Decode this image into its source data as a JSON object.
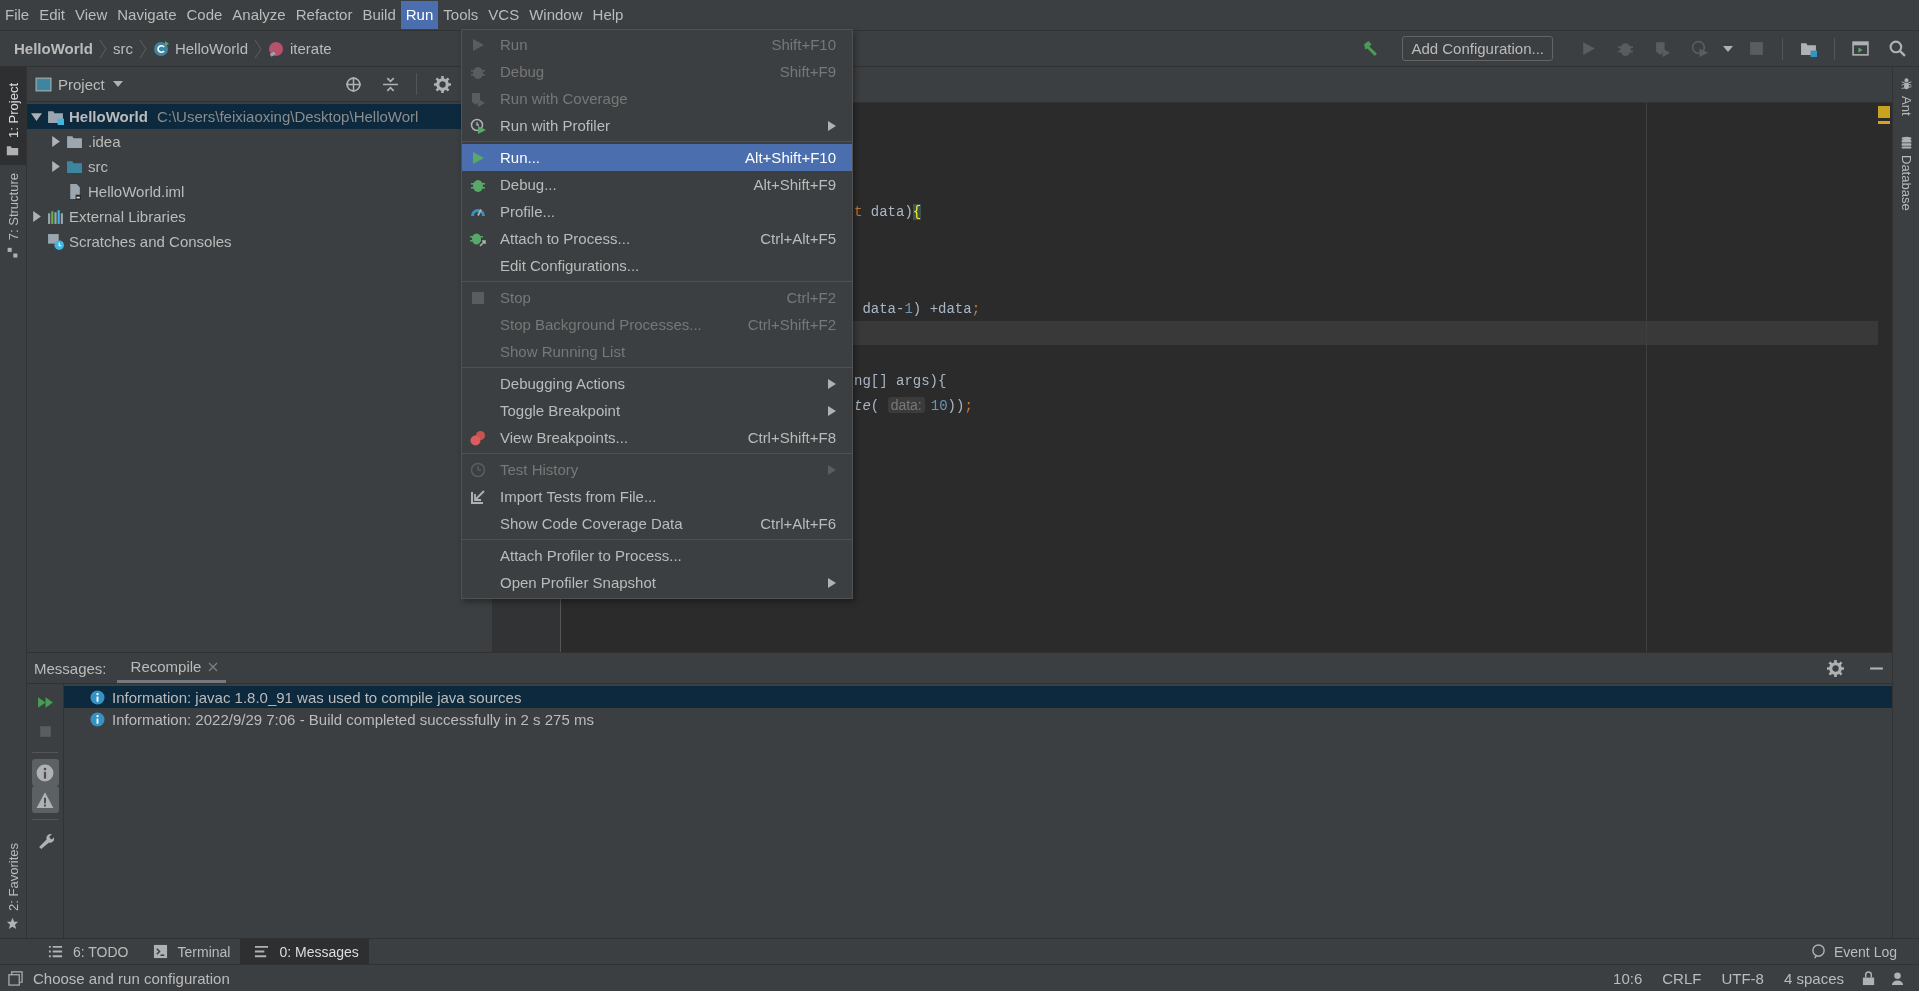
{
  "menu_bar": [
    {
      "label": "File",
      "selected": false
    },
    {
      "label": "Edit",
      "selected": false
    },
    {
      "label": "View",
      "selected": false
    },
    {
      "label": "Navigate",
      "selected": false
    },
    {
      "label": "Code",
      "selected": false
    },
    {
      "label": "Analyze",
      "selected": false
    },
    {
      "label": "Refactor",
      "selected": false
    },
    {
      "label": "Build",
      "selected": false
    },
    {
      "label": "Run",
      "selected": true
    },
    {
      "label": "Tools",
      "selected": false
    },
    {
      "label": "VCS",
      "selected": false
    },
    {
      "label": "Window",
      "selected": false
    },
    {
      "label": "Help",
      "selected": false
    }
  ],
  "breadcrumbs": [
    {
      "label": "HelloWorld",
      "kind": "project"
    },
    {
      "label": "src",
      "kind": "folder"
    },
    {
      "label": "HelloWorld",
      "kind": "class"
    },
    {
      "label": "iterate",
      "kind": "method"
    }
  ],
  "toolbar": {
    "configuration": "Add Configuration..."
  },
  "left_stripe": [
    {
      "label": "1: Project",
      "selected": true,
      "kind": "project"
    },
    {
      "label": "7: Structure",
      "selected": false,
      "kind": "structure"
    }
  ],
  "favorites_tab": {
    "label": "2: Favorites"
  },
  "right_stripe": [
    {
      "label": "Ant",
      "kind": "ant"
    },
    {
      "label": "Database",
      "kind": "database"
    }
  ],
  "project_panel": {
    "title": "Project",
    "tree": [
      {
        "label": "HelloWorld",
        "path": "C:\\Users\\feixiaoxing\\Desktop\\HelloWorl",
        "kind": "module",
        "expanded": true,
        "selected": true,
        "children": [
          {
            "label": ".idea",
            "kind": "folder",
            "expanded": false,
            "selected": false
          },
          {
            "label": "src",
            "kind": "source-folder",
            "expanded": false,
            "selected": false
          },
          {
            "label": "HelloWorld.iml",
            "kind": "iml-file",
            "selected": false
          }
        ]
      },
      {
        "label": "External Libraries",
        "kind": "libraries",
        "expanded": false,
        "selected": false
      },
      {
        "label": "Scratches and Consoles",
        "kind": "scratches",
        "selected": false
      }
    ]
  },
  "editor": {
    "lines": [
      {
        "current": false
      },
      {
        "current": false
      },
      {
        "current": false
      },
      {
        "current": false
      },
      {
        "current": false,
        "tokens": [
          {
            "text": "t",
            "kind": "keyword"
          },
          {
            "text": " data)",
            "kind": "plain"
          },
          {
            "text": "{",
            "kind": "brace"
          }
        ]
      },
      {
        "current": false
      },
      {
        "current": false
      },
      {
        "current": false
      },
      {
        "current": false,
        "tokens": [
          {
            "text": " data-",
            "kind": "plain"
          },
          {
            "text": "1",
            "kind": "number"
          },
          {
            "text": ") +data",
            "kind": "plain"
          },
          {
            "text": ";",
            "kind": "keyword"
          }
        ]
      },
      {
        "current": true
      },
      {
        "current": false
      },
      {
        "current": false,
        "tokens": [
          {
            "text": "ng[] args){",
            "kind": "plain"
          }
        ]
      },
      {
        "current": false,
        "tokens": [
          {
            "text": "te",
            "kind": "italic"
          },
          {
            "text": "( ",
            "kind": "plain"
          },
          {
            "text": "data:",
            "kind": "hint"
          },
          {
            "text": "10",
            "kind": "number"
          },
          {
            "text": "))",
            "kind": "plain"
          },
          {
            "text": ";",
            "kind": "keyword"
          }
        ]
      }
    ]
  },
  "run_menu": [
    {
      "kind": "run",
      "label": "Run",
      "shortcut": "Shift+F10",
      "disabled": true,
      "selected": false,
      "submenu": false
    },
    {
      "kind": "debug",
      "label": "Debug",
      "shortcut": "Shift+F9",
      "disabled": true,
      "selected": false,
      "submenu": false
    },
    {
      "kind": "coverage",
      "label": "Run with Coverage",
      "disabled": true,
      "selected": false,
      "submenu": false
    },
    {
      "kind": "profiler",
      "label": "Run with Profiler",
      "disabled": false,
      "selected": false,
      "submenu": true
    },
    {
      "kind": "separator"
    },
    {
      "kind": "run",
      "label": "Run...",
      "shortcut": "Alt+Shift+F10",
      "disabled": false,
      "selected": true,
      "submenu": false
    },
    {
      "kind": "debug",
      "label": "Debug...",
      "shortcut": "Alt+Shift+F9",
      "disabled": false,
      "selected": false,
      "submenu": false
    },
    {
      "kind": "profile",
      "label": "Profile...",
      "disabled": false,
      "selected": false,
      "submenu": false
    },
    {
      "kind": "attach",
      "label": "Attach to Process...",
      "shortcut": "Ctrl+Alt+F5",
      "disabled": false,
      "selected": false,
      "submenu": false
    },
    {
      "kind": "item",
      "label": "Edit Configurations...",
      "disabled": false,
      "selected": false,
      "submenu": false
    },
    {
      "kind": "separator"
    },
    {
      "kind": "stop",
      "label": "Stop",
      "shortcut": "Ctrl+F2",
      "disabled": true,
      "selected": false,
      "submenu": false
    },
    {
      "kind": "item",
      "label": "Stop Background Processes...",
      "shortcut": "Ctrl+Shift+F2",
      "disabled": true,
      "selected": false,
      "submenu": false
    },
    {
      "kind": "item",
      "label": "Show Running List",
      "disabled": true,
      "selected": false,
      "submenu": false
    },
    {
      "kind": "separator"
    },
    {
      "kind": "item",
      "label": "Debugging Actions",
      "disabled": false,
      "selected": false,
      "submenu": true
    },
    {
      "kind": "item",
      "label": "Toggle Breakpoint",
      "disabled": false,
      "selected": false,
      "submenu": true
    },
    {
      "kind": "breakpoints",
      "label": "View Breakpoints...",
      "shortcut": "Ctrl+Shift+F8",
      "disabled": false,
      "selected": false,
      "submenu": false
    },
    {
      "kind": "separator"
    },
    {
      "kind": "history",
      "label": "Test History",
      "disabled": true,
      "selected": false,
      "submenu": true
    },
    {
      "kind": "import",
      "label": "Import Tests from File...",
      "disabled": false,
      "selected": false,
      "submenu": false
    },
    {
      "kind": "item",
      "label": "Show Code Coverage Data",
      "shortcut": "Ctrl+Alt+F6",
      "disabled": false,
      "selected": false,
      "submenu": false
    },
    {
      "kind": "separator"
    },
    {
      "kind": "item",
      "label": "Attach Profiler to Process...",
      "disabled": false,
      "selected": false,
      "submenu": false
    },
    {
      "kind": "item",
      "label": "Open Profiler Snapshot",
      "disabled": false,
      "selected": false,
      "submenu": true
    }
  ],
  "messages": {
    "title": "Messages:",
    "tabs": [
      {
        "label": "Recompile",
        "selected": true
      }
    ],
    "filters": [
      {
        "kind": "info",
        "on": true
      },
      {
        "kind": "warning",
        "on": true
      }
    ],
    "rows": [
      {
        "text": "Information: javac 1.8.0_91 was used to compile java sources",
        "selected": true
      },
      {
        "text": "Information: 2022/9/29 7:06 - Build completed successfully in 2 s 275 ms",
        "selected": false
      }
    ]
  },
  "tool_tabs": [
    {
      "label": "6: TODO",
      "kind": "todo",
      "selected": false
    },
    {
      "label": "Terminal",
      "kind": "terminal",
      "selected": false
    },
    {
      "label": "0: Messages",
      "kind": "messages",
      "selected": true
    }
  ],
  "event_log": "Event Log",
  "status_bar": {
    "message": "Choose and run configuration",
    "items": [
      "10:6",
      "CRLF",
      "UTF-8",
      "4 spaces"
    ]
  }
}
